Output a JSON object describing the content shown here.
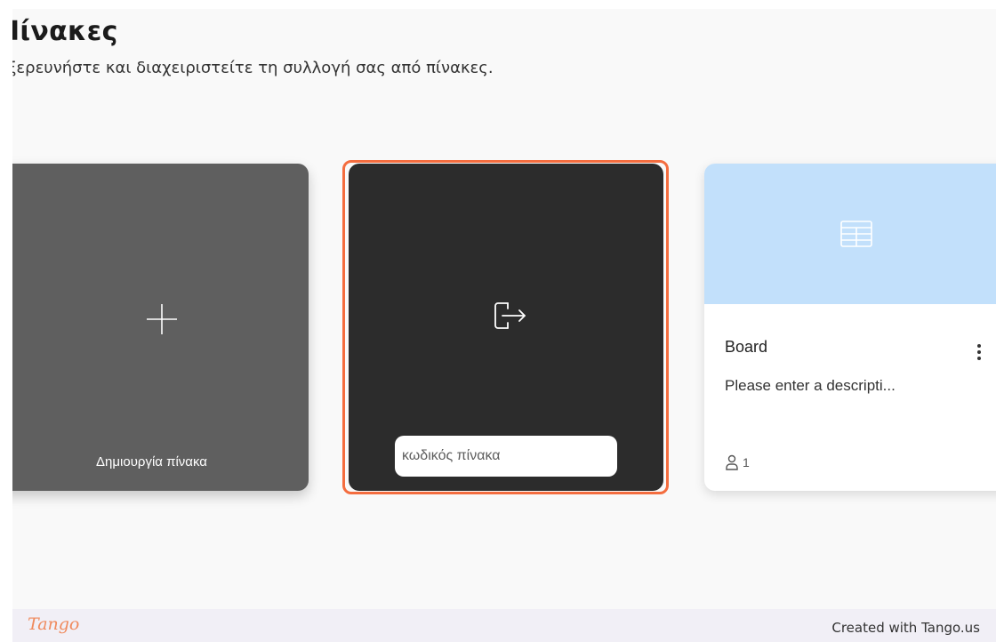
{
  "page": {
    "title": "Πίνακες",
    "subtitle": "Εξερευνήστε και διαχειριστείτε τη συλλογή σας από πίνακες."
  },
  "create_card": {
    "label": "Δημιουργία πίνακα",
    "icon": "plus-icon"
  },
  "join_card": {
    "icon": "login-icon",
    "input_placeholder": "κωδικός πίνακα",
    "input_value": ""
  },
  "board_card": {
    "name": "Board",
    "description": "Please enter a descripti...",
    "members": "1",
    "cover_color": "#c2e0fb",
    "cover_icon": "table-icon"
  },
  "colors": {
    "highlight": "#f46d3f",
    "create_card_bg": "#5f5f5f",
    "join_card_bg": "#2c2c2c"
  },
  "footer": {
    "logo": "Tango",
    "credit": "Created with Tango.us"
  }
}
